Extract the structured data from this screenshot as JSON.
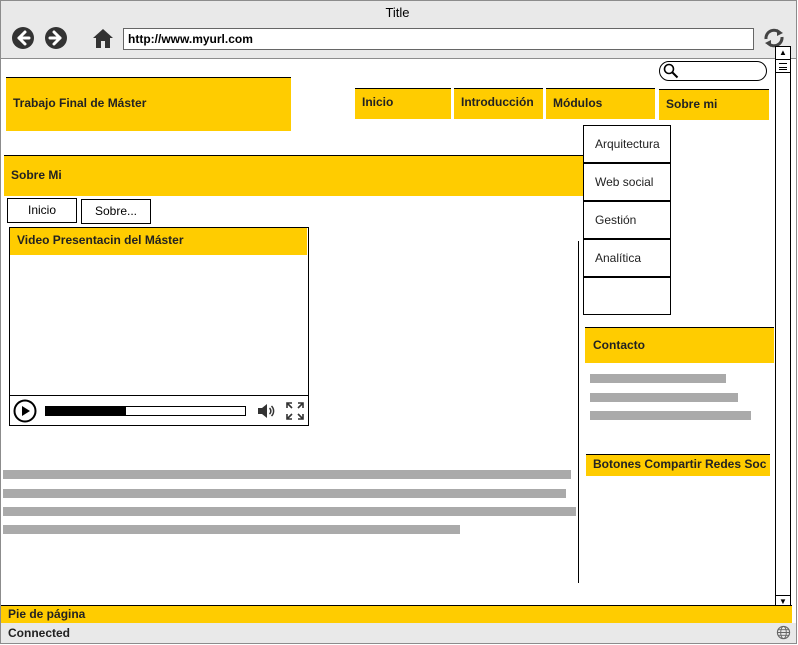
{
  "window": {
    "title": "Title"
  },
  "browser": {
    "url": "http://www.myurl.com"
  },
  "header": {
    "site_title": "Trabajo Final de Máster"
  },
  "nav": {
    "items": [
      "Inicio",
      "Introducción",
      "Módulos",
      "Sobre mi"
    ]
  },
  "dropdown": {
    "items": [
      "Arquitectura",
      "Web social",
      "Gestión",
      "Analítica",
      ""
    ]
  },
  "section": {
    "title": "Sobre Mi"
  },
  "breadcrumb": {
    "items": [
      "Inicio",
      "Sobre..."
    ]
  },
  "video": {
    "title": "Video Presentacin del Máster",
    "progress": 0.4
  },
  "sidebar": {
    "contact_title": "Contacto",
    "share_title": "Botones Compartir Redes Soc"
  },
  "footer": {
    "label": "Pie de página"
  },
  "status": {
    "text": "Connected"
  },
  "colors": {
    "accent": "#ffcc00",
    "placeholder_bar": "#aaaaaa",
    "chrome": "#e9e9e9"
  }
}
